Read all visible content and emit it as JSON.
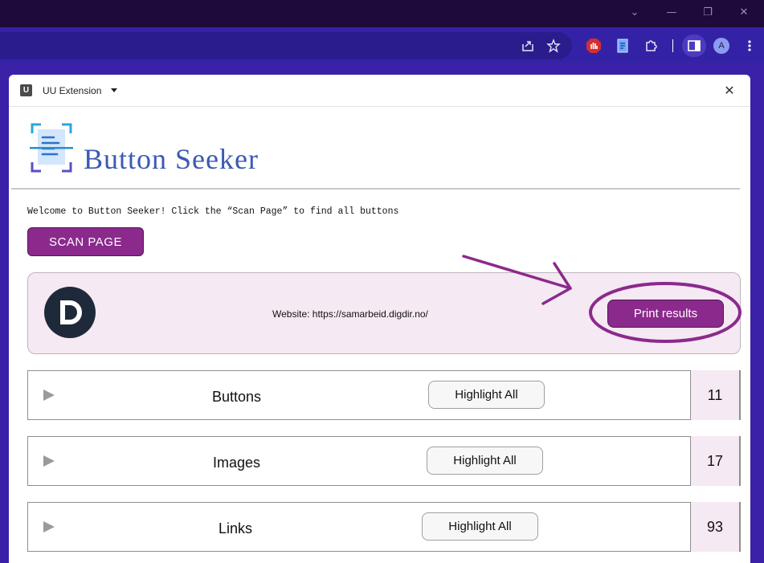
{
  "browser": {
    "window_controls": {
      "dropdown": "⌄",
      "minimize": "—",
      "restore": "❐",
      "close": "✕"
    },
    "toolbar_icons": [
      "share-icon",
      "star-icon",
      "adblock-icon",
      "extension-doc-icon",
      "puzzle-icon",
      "side-panel-icon",
      "profile-avatar",
      "menu-dots-icon"
    ],
    "profile_initial": "A"
  },
  "panel": {
    "extension_badge": "U",
    "extension_name": "UU Extension",
    "close_glyph": "✕"
  },
  "app": {
    "title": "Button Seeker",
    "welcome_text": "Welcome to Button Seeker! Click the “Scan Page” to find all buttons",
    "scan_button_label": "SCAN PAGE",
    "website_text": "Website: https://samarbeid.digdir.no/",
    "print_button_label": "Print results",
    "highlight_label": "Highlight All",
    "categories": [
      {
        "label": "Buttons",
        "count": "11"
      },
      {
        "label": "Images",
        "count": "17"
      },
      {
        "label": "Links",
        "count": "93"
      }
    ]
  },
  "colors": {
    "chrome_dark": "#1f0a3c",
    "chrome_toolbar": "#3422a6",
    "accent_purple": "#8b2a8c",
    "card_bg": "#f5e9f3",
    "title_blue": "#3a5ab4"
  }
}
